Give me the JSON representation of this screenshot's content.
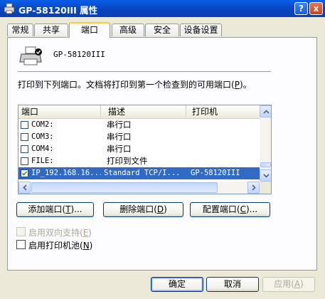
{
  "window": {
    "title": "GP-58120III 属性",
    "help_label": "?",
    "close_label": "x"
  },
  "tabs": [
    {
      "label": "常规"
    },
    {
      "label": "共享"
    },
    {
      "label": "端口",
      "active": true
    },
    {
      "label": "高级"
    },
    {
      "label": "安全"
    },
    {
      "label": "设备设置"
    }
  ],
  "printer": {
    "name": "GP-58120III",
    "icon": "printer-icon"
  },
  "instruction": {
    "text": "打印到下列端口。文档将打印到第一个检查到的可用端口(",
    "key": "P",
    "suffix": ")。"
  },
  "port_list": {
    "columns": [
      "端口",
      "描述",
      "打印机"
    ],
    "rows": [
      {
        "checked": false,
        "port": "COM2:",
        "desc": "串行口",
        "printer": "",
        "selected": false
      },
      {
        "checked": false,
        "port": "COM3:",
        "desc": "串行口",
        "printer": "",
        "selected": false
      },
      {
        "checked": false,
        "port": "COM4:",
        "desc": "串行口",
        "printer": "",
        "selected": false
      },
      {
        "checked": false,
        "port": "FILE:",
        "desc": "打印到文件",
        "printer": "",
        "selected": false
      },
      {
        "checked": true,
        "port": "IP_192.168.16...",
        "desc": "Standard TCP/I...",
        "printer": "GP-58120III",
        "selected": true
      }
    ]
  },
  "port_buttons": {
    "add": {
      "label": "添加端口(",
      "key": "T",
      "suffix": ")..."
    },
    "delete": {
      "label": "删除端口(",
      "key": "D",
      "suffix": ")"
    },
    "configure": {
      "label": "配置端口(",
      "key": "C",
      "suffix": ")..."
    }
  },
  "options": {
    "bidirectional": {
      "label": "启用双向支持(",
      "key": "E",
      "suffix": ")",
      "enabled": false,
      "checked": false
    },
    "pooling": {
      "label": "启用打印机池(",
      "key": "N",
      "suffix": ")",
      "enabled": true,
      "checked": false
    }
  },
  "dialog_buttons": {
    "ok": "确定",
    "cancel": "取消",
    "apply": {
      "label": "应用(",
      "key": "A",
      "suffix": ")",
      "enabled": false
    }
  }
}
